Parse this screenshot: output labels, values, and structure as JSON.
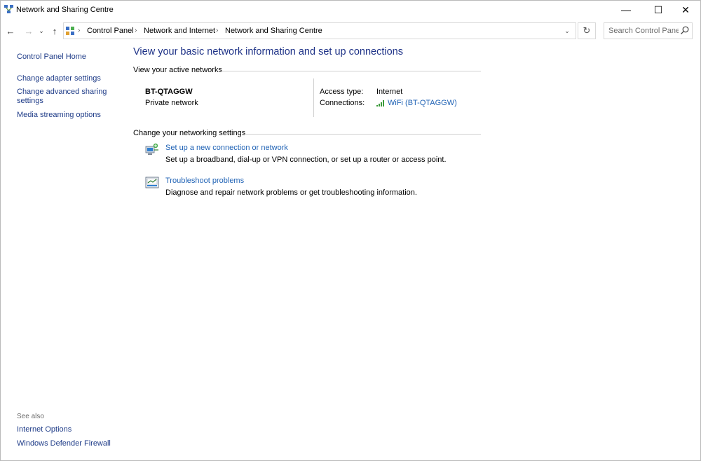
{
  "window": {
    "title": "Network and Sharing Centre",
    "minimize_glyph": "—",
    "maximize_glyph": "☐",
    "close_glyph": "✕"
  },
  "nav": {
    "back_glyph": "←",
    "forward_glyph": "→",
    "recent_glyph": "⌄",
    "up_glyph": "↑",
    "refresh_glyph": "↻",
    "dropdown_glyph": "⌄"
  },
  "breadcrumb": {
    "items": [
      "Control Panel",
      "Network and Internet",
      "Network and Sharing Centre"
    ],
    "separator": "›"
  },
  "search": {
    "placeholder": "Search Control Panel"
  },
  "sidebar": {
    "links": [
      "Control Panel Home",
      "Change adapter settings",
      "Change advanced sharing settings",
      "Media streaming options"
    ],
    "see_also_label": "See also",
    "see_also_links": [
      "Internet Options",
      "Windows Defender Firewall"
    ]
  },
  "main": {
    "heading": "View your basic network information and set up connections",
    "active_networks_title": "View your active networks",
    "network": {
      "name": "BT-QTAGGW",
      "type": "Private network",
      "access_type_label": "Access type:",
      "access_type_value": "Internet",
      "connections_label": "Connections:",
      "connection_link": "WiFi (BT-QTAGGW)"
    },
    "settings_title": "Change your networking settings",
    "tasks": [
      {
        "link": "Set up a new connection or network",
        "description": "Set up a broadband, dial-up or VPN connection, or set up a router or access point."
      },
      {
        "link": "Troubleshoot problems",
        "description": "Diagnose and repair network problems or get troubleshooting information."
      }
    ]
  },
  "icons": {
    "app": "network-sharing-icon",
    "control_panel": "control-panel-icon",
    "search": "search-icon",
    "wifi": "wifi-signal-icon",
    "new_connection": "new-connection-icon",
    "troubleshoot": "troubleshoot-icon"
  },
  "colors": {
    "link": "#1f62b5",
    "heading": "#1e3287",
    "sidebar_link": "#1f3c88",
    "wifi_bars": "#3a9a3a"
  }
}
